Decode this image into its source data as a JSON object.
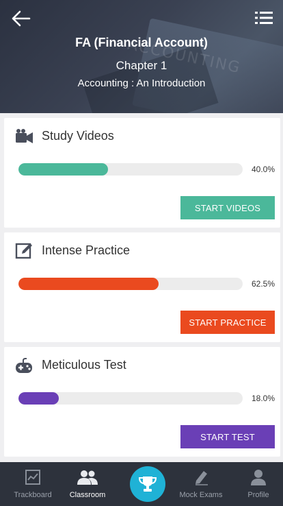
{
  "header": {
    "title": "FA (Financial Account)",
    "chapter": "Chapter 1",
    "subtitle": "Accounting : An Introduction",
    "back_icon": "arrow-left-icon",
    "menu_icon": "list-menu-icon",
    "background_text": "ACCOUNTING"
  },
  "cards": [
    {
      "title": "Study Videos",
      "icon": "video-camera-icon",
      "progress": 0.4,
      "progress_label": "40.0%",
      "button_label": "START VIDEOS",
      "color": "#4bb89a"
    },
    {
      "title": "Intense Practice",
      "icon": "edit-pencil-icon",
      "progress": 0.625,
      "progress_label": "62.5%",
      "button_label": "START PRACTICE",
      "color": "#ea4a1f"
    },
    {
      "title": "Meticulous Test",
      "icon": "gamepad-icon",
      "progress": 0.18,
      "progress_label": "18.0%",
      "button_label": "START TEST",
      "color": "#6a3fb6"
    }
  ],
  "bottom_nav": {
    "items": [
      {
        "label": "Trackboard",
        "icon": "chart-board-icon",
        "active": false
      },
      {
        "label": "Classroom",
        "icon": "users-icon",
        "active": true
      },
      {
        "label": "Mock Exams",
        "icon": "pencil-icon",
        "active": false
      },
      {
        "label": "Profile",
        "icon": "user-icon",
        "active": false
      }
    ],
    "center_icon": "trophy-icon",
    "center_color": "#1fb2d6"
  }
}
